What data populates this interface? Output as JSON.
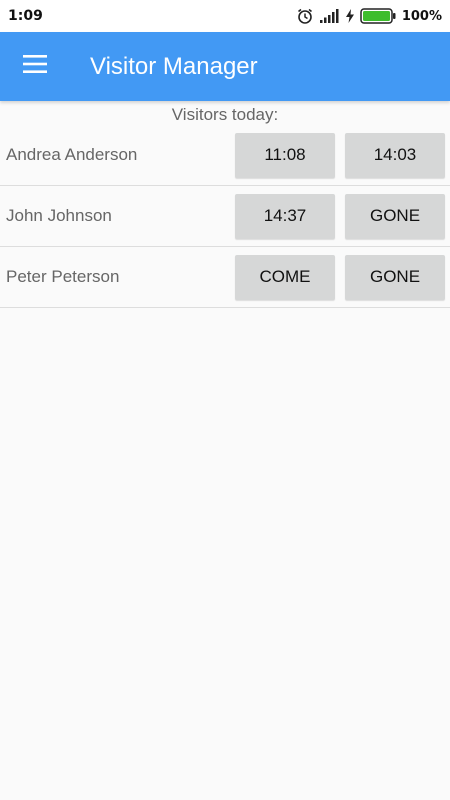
{
  "status_bar": {
    "time": "1:09",
    "battery_percent": "100%",
    "icons": [
      "alarm-icon",
      "signal-icon",
      "charging-icon",
      "battery-icon"
    ]
  },
  "app_bar": {
    "title": "Visitor Manager",
    "menu_icon": "hamburger-menu-icon",
    "color": "#4299f4"
  },
  "main": {
    "subheader": "Visitors today:",
    "visitors": [
      {
        "name": "Andrea Anderson",
        "come": "11:08",
        "gone": "14:03"
      },
      {
        "name": "John Johnson",
        "come": "14:37",
        "gone": "GONE"
      },
      {
        "name": "Peter Peterson",
        "come": "COME",
        "gone": "GONE"
      }
    ]
  }
}
